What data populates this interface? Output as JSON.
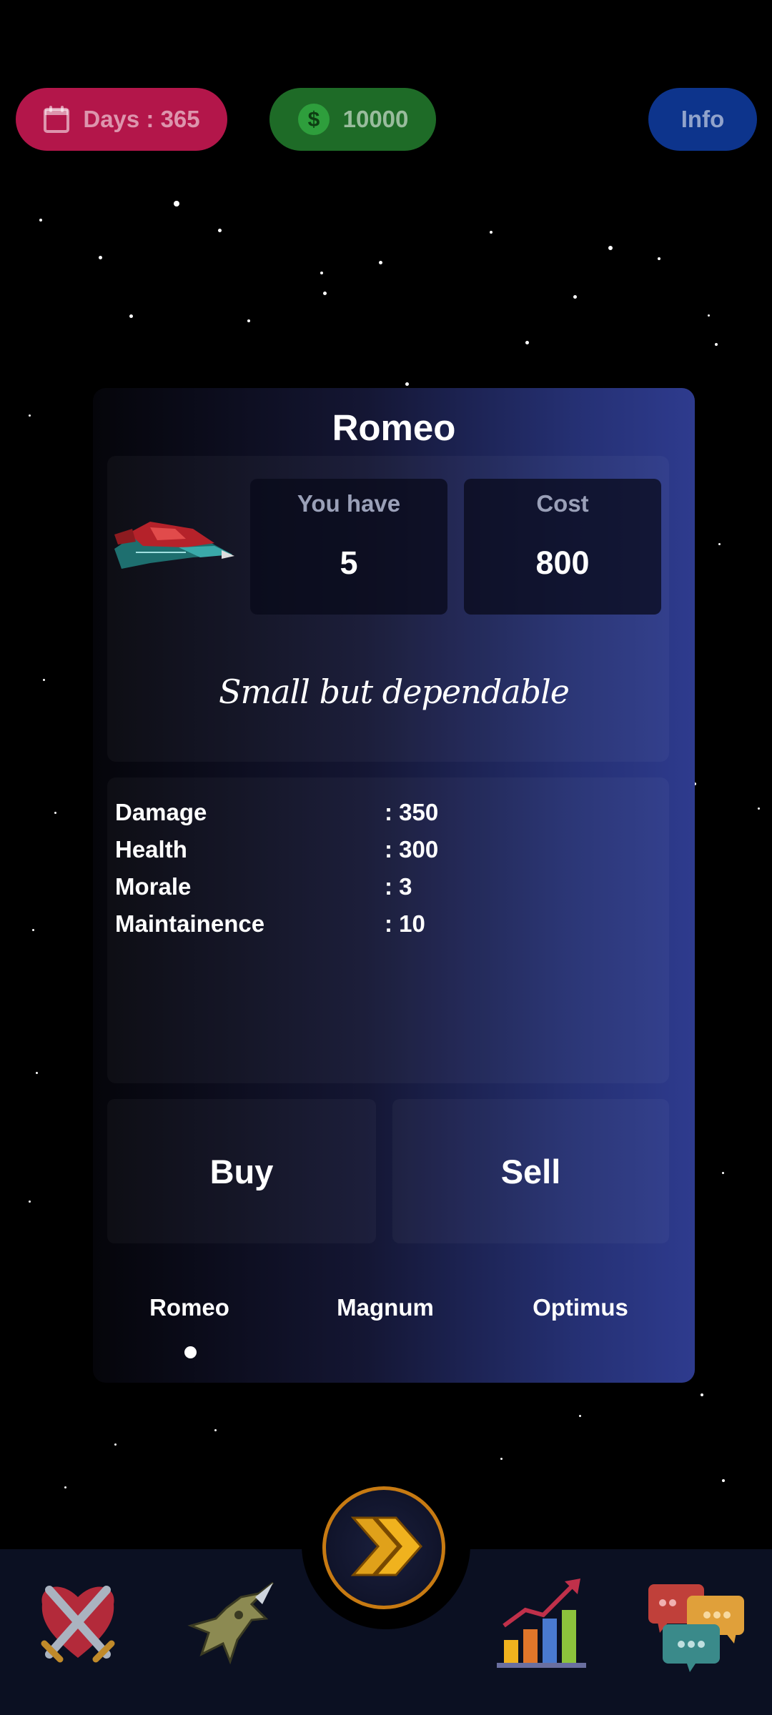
{
  "topbar": {
    "days_label": "Days : 365",
    "money_label": "10000",
    "info_label": "Info"
  },
  "card": {
    "title": "Romeo",
    "you_have_label": "You have",
    "you_have_value": "5",
    "cost_label": "Cost",
    "cost_value": "800",
    "tagline": "Small but dependable",
    "stats": [
      {
        "name": "Damage",
        "value": ": 350"
      },
      {
        "name": "Health",
        "value": ": 300"
      },
      {
        "name": "Morale",
        "value": ": 3"
      },
      {
        "name": "Maintainence",
        "value": ": 10"
      }
    ],
    "buy_label": "Buy",
    "sell_label": "Sell",
    "tabs": [
      {
        "label": "Romeo",
        "active": true
      },
      {
        "label": "Magnum",
        "active": false
      },
      {
        "label": "Optimus",
        "active": false
      }
    ]
  },
  "bottom_nav": {
    "items": [
      "battle-icon",
      "fighter-jet-icon",
      "next-turn-icon",
      "stats-chart-icon",
      "chat-icon"
    ]
  },
  "colors": {
    "days_pill": "#b3164a",
    "money_pill": "#1e6b27",
    "info_pill": "#0d348c",
    "accent_orange": "#c77a12"
  }
}
